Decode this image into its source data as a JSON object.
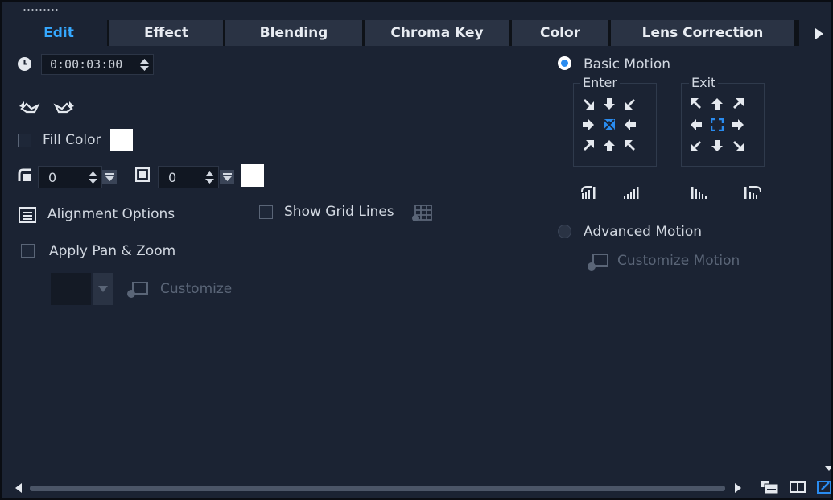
{
  "tabs": [
    {
      "label": "Edit",
      "active": true
    },
    {
      "label": "Effect",
      "active": false
    },
    {
      "label": "Blending",
      "active": false
    },
    {
      "label": "Chroma Key",
      "active": false
    },
    {
      "label": "Color",
      "active": false
    },
    {
      "label": "Lens Correction",
      "active": false
    }
  ],
  "duration": {
    "value": "0:00:03:00",
    "icon": "clock-icon"
  },
  "fill_color": {
    "label": "Fill Color",
    "checked": false,
    "swatch": "#ffffff"
  },
  "border": {
    "size_value": "0",
    "shadow_value": "0",
    "color": "#ffffff"
  },
  "alignment": {
    "label": "Alignment Options"
  },
  "grid_lines": {
    "label": "Show Grid Lines",
    "checked": false
  },
  "pan_zoom": {
    "label": "Apply Pan & Zoom",
    "checked": false,
    "customize_label": "Customize"
  },
  "motion": {
    "basic_label": "Basic Motion",
    "basic_selected": true,
    "enter_label": "Enter",
    "exit_label": "Exit",
    "advanced_label": "Advanced Motion",
    "advanced_selected": false,
    "customize_motion_label": "Customize Motion"
  },
  "colors": {
    "background": "#1b2333",
    "accent": "#35a8ff",
    "tab_inactive": "#2a3344",
    "disabled_text": "#5a6577"
  }
}
